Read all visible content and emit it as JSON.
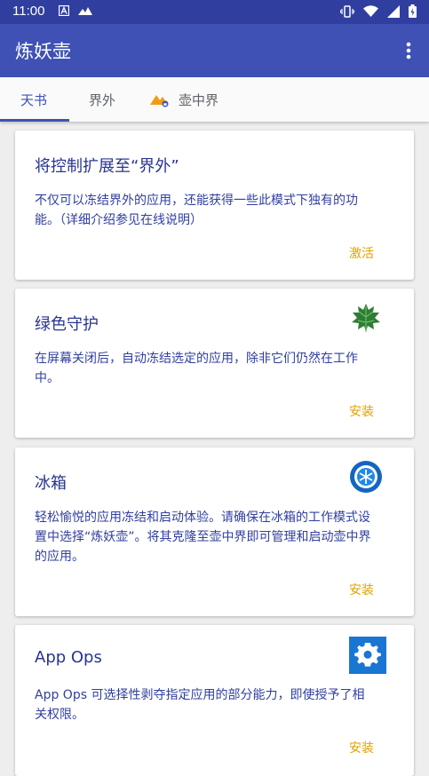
{
  "status_bar": {
    "time": "11:00",
    "icons_left": [
      "a-notification-icon",
      "image-notification-icon"
    ],
    "icons_right": [
      "vibrate-icon",
      "wifi-icon",
      "signal-icon",
      "battery-icon"
    ]
  },
  "app_bar": {
    "title": "炼妖壶",
    "more_icon": "more-vert-icon"
  },
  "tabs": [
    {
      "label": "天书",
      "active": true
    },
    {
      "label": "界外",
      "active": false
    },
    {
      "label": "壶中界",
      "active": false,
      "icon": "island-lock-icon"
    }
  ],
  "cards": [
    {
      "title": "将控制扩展至“界外”",
      "desc_lines": [
        "不仅可以冻结界外的应用，还能获得一些此模式下独有的功",
        "能。（详细介绍参见在线说明）"
      ],
      "action": "激活"
    },
    {
      "title": "绿色守护",
      "desc_lines": [
        "在屏幕关闭后，自动冻结选定的应用，除非它们仍然在工作",
        "中。"
      ],
      "action": "安装",
      "icon": "greenify-leaf-icon"
    },
    {
      "title": "冰箱",
      "desc_lines": [
        "轻松愉悦的应用冻结和启动体验。请确保在冰箱的工作模式设",
        "置中选择“炼妖壶”。将其克隆至壶中界即可管理和启动壶中界",
        "的应用。"
      ],
      "action": "安装",
      "icon": "icebox-snowflake-icon"
    },
    {
      "title": "App Ops",
      "desc_lines": [
        "App Ops 可选择性剥夺指定应用的部分能力，即使授予了相",
        "关权限。"
      ],
      "action": "安装",
      "icon": "app-ops-gear-icon"
    }
  ],
  "colors": {
    "primary": "#3f51b5",
    "primary_dark": "#303f9f",
    "accent": "#e0a200"
  }
}
